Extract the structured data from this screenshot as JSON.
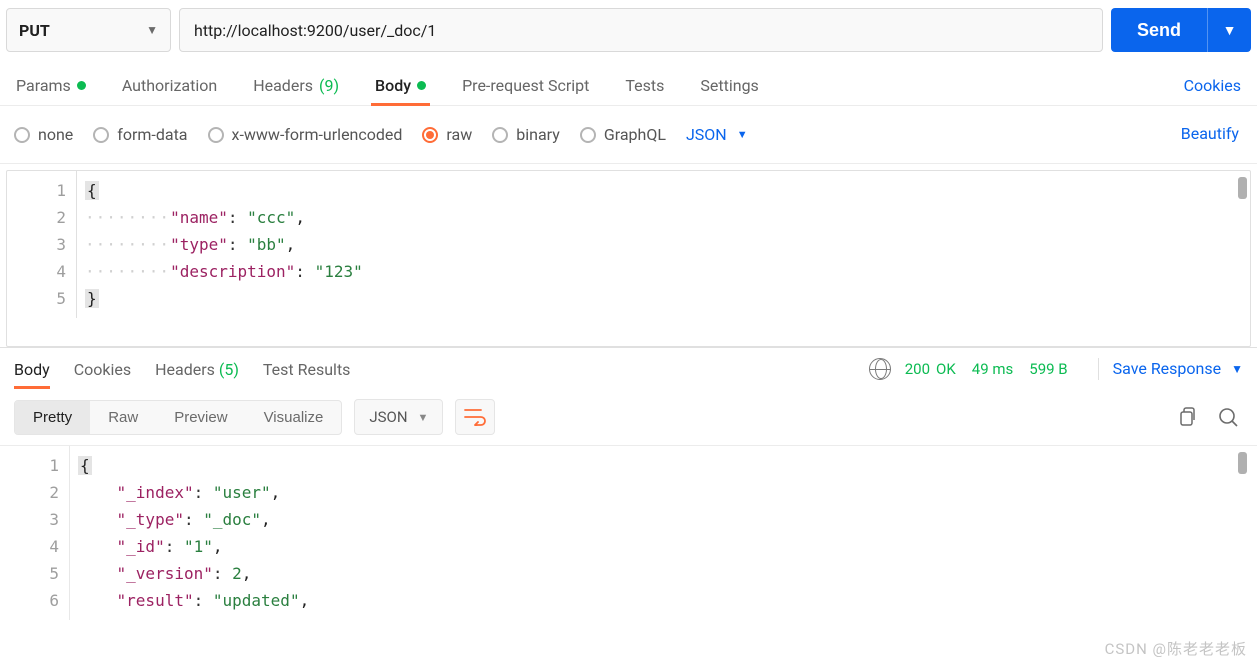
{
  "request": {
    "method": "PUT",
    "url": "http://localhost:9200/user/_doc/1",
    "send_label": "Send"
  },
  "tabs": {
    "items": [
      {
        "label": "Params",
        "dot": true
      },
      {
        "label": "Authorization"
      },
      {
        "label": "Headers",
        "count": "(9)"
      },
      {
        "label": "Body",
        "dot": true,
        "active": true
      },
      {
        "label": "Pre-request Script"
      },
      {
        "label": "Tests"
      },
      {
        "label": "Settings"
      }
    ],
    "cookies_label": "Cookies"
  },
  "body": {
    "types": [
      "none",
      "form-data",
      "x-www-form-urlencoded",
      "raw",
      "binary",
      "GraphQL"
    ],
    "selected": "raw",
    "format": "JSON",
    "beautify_label": "Beautify",
    "code": {
      "gutter": [
        "1",
        "2",
        "3",
        "4",
        "5"
      ],
      "lines": [
        {
          "kind": "brace",
          "t": "{"
        },
        {
          "kind": "kv",
          "k": "name",
          "v": "ccc",
          "vt": "str",
          "comma": true,
          "indent": true
        },
        {
          "kind": "kv",
          "k": "type",
          "v": "bb",
          "vt": "str",
          "comma": true,
          "indent": true
        },
        {
          "kind": "kv",
          "k": "description",
          "v": "123",
          "vt": "str",
          "comma": false,
          "indent": true
        },
        {
          "kind": "brace",
          "t": "}"
        }
      ]
    }
  },
  "response": {
    "tabs": [
      {
        "label": "Body",
        "active": true
      },
      {
        "label": "Cookies"
      },
      {
        "label": "Headers",
        "count": "(5)"
      },
      {
        "label": "Test Results"
      }
    ],
    "status_code": "200",
    "status_text": "OK",
    "time": "49 ms",
    "size": "599 B",
    "save_label": "Save Response",
    "view": {
      "modes": [
        "Pretty",
        "Raw",
        "Preview",
        "Visualize"
      ],
      "active": "Pretty",
      "format": "JSON"
    },
    "code": {
      "gutter": [
        "1",
        "2",
        "3",
        "4",
        "5",
        "6"
      ],
      "lines": [
        {
          "kind": "brace",
          "t": "{"
        },
        {
          "kind": "kv",
          "k": "_index",
          "v": "user",
          "vt": "str",
          "comma": true
        },
        {
          "kind": "kv",
          "k": "_type",
          "v": "_doc",
          "vt": "str",
          "comma": true
        },
        {
          "kind": "kv",
          "k": "_id",
          "v": "1",
          "vt": "str",
          "comma": true
        },
        {
          "kind": "kv",
          "k": "_version",
          "v": "2",
          "vt": "num",
          "comma": true
        },
        {
          "kind": "kv",
          "k": "result",
          "v": "updated",
          "vt": "str",
          "comma": true
        }
      ]
    }
  },
  "watermark": "CSDN @陈老老老板"
}
